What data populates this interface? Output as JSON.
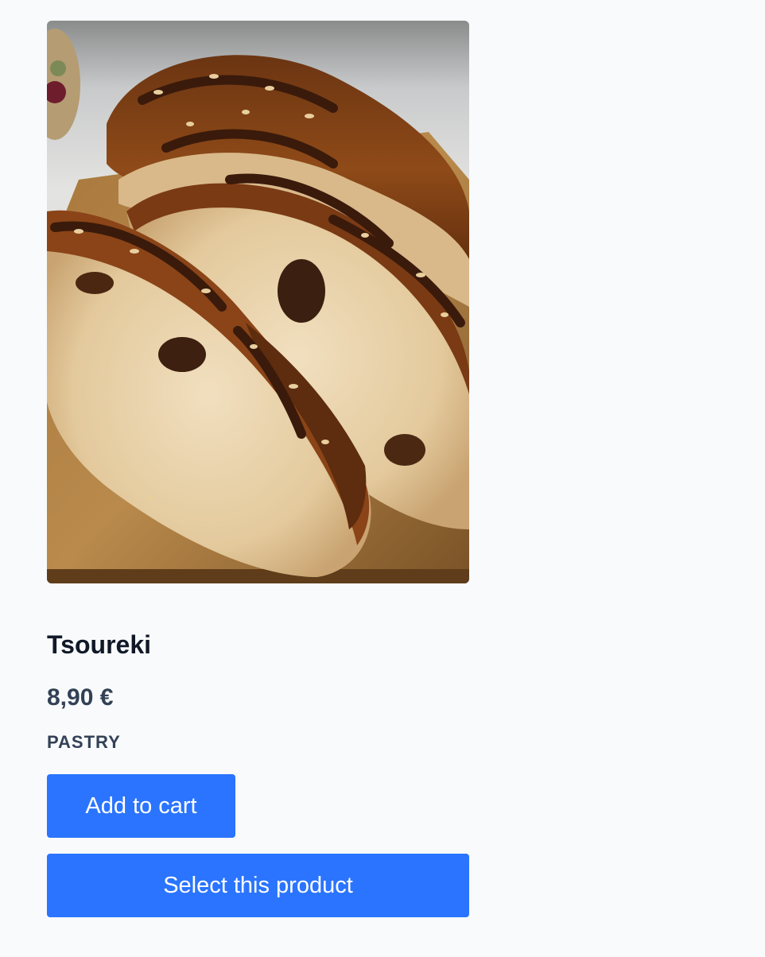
{
  "product": {
    "image_alt": "Tsoureki",
    "title": "Tsoureki",
    "price": "8,90 €",
    "category": "PASTRY"
  },
  "actions": {
    "add_to_cart_label": "Add to cart",
    "select_label": "Select this product"
  },
  "colors": {
    "page_background": "#f8fafc",
    "button_background": "#2a74ff",
    "title_text": "#111827",
    "secondary_text": "#334155"
  }
}
